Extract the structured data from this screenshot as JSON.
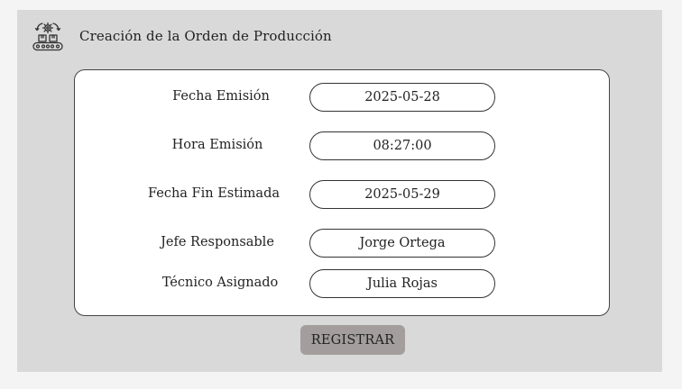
{
  "header": {
    "icon": "production-line-icon",
    "title": "Creación de la Orden de Producción"
  },
  "form": {
    "fields": [
      {
        "label": "Fecha Emisión",
        "value": "2025-05-28"
      },
      {
        "label": "Hora Emisión",
        "value": "08:27:00"
      },
      {
        "label": "Fecha Fin Estimada",
        "value": "2025-05-29"
      },
      {
        "label": "Jefe Responsable",
        "value": "Jorge Ortega"
      },
      {
        "label": "Técnico Asignado",
        "value": "Julia Rojas"
      }
    ]
  },
  "actions": {
    "register_label": "REGISTRAR"
  },
  "colors": {
    "page_background": "#f4f4f4",
    "panel_background": "#d9d9d9",
    "card_background": "#ffffff",
    "button_background": "#a39d9d"
  }
}
